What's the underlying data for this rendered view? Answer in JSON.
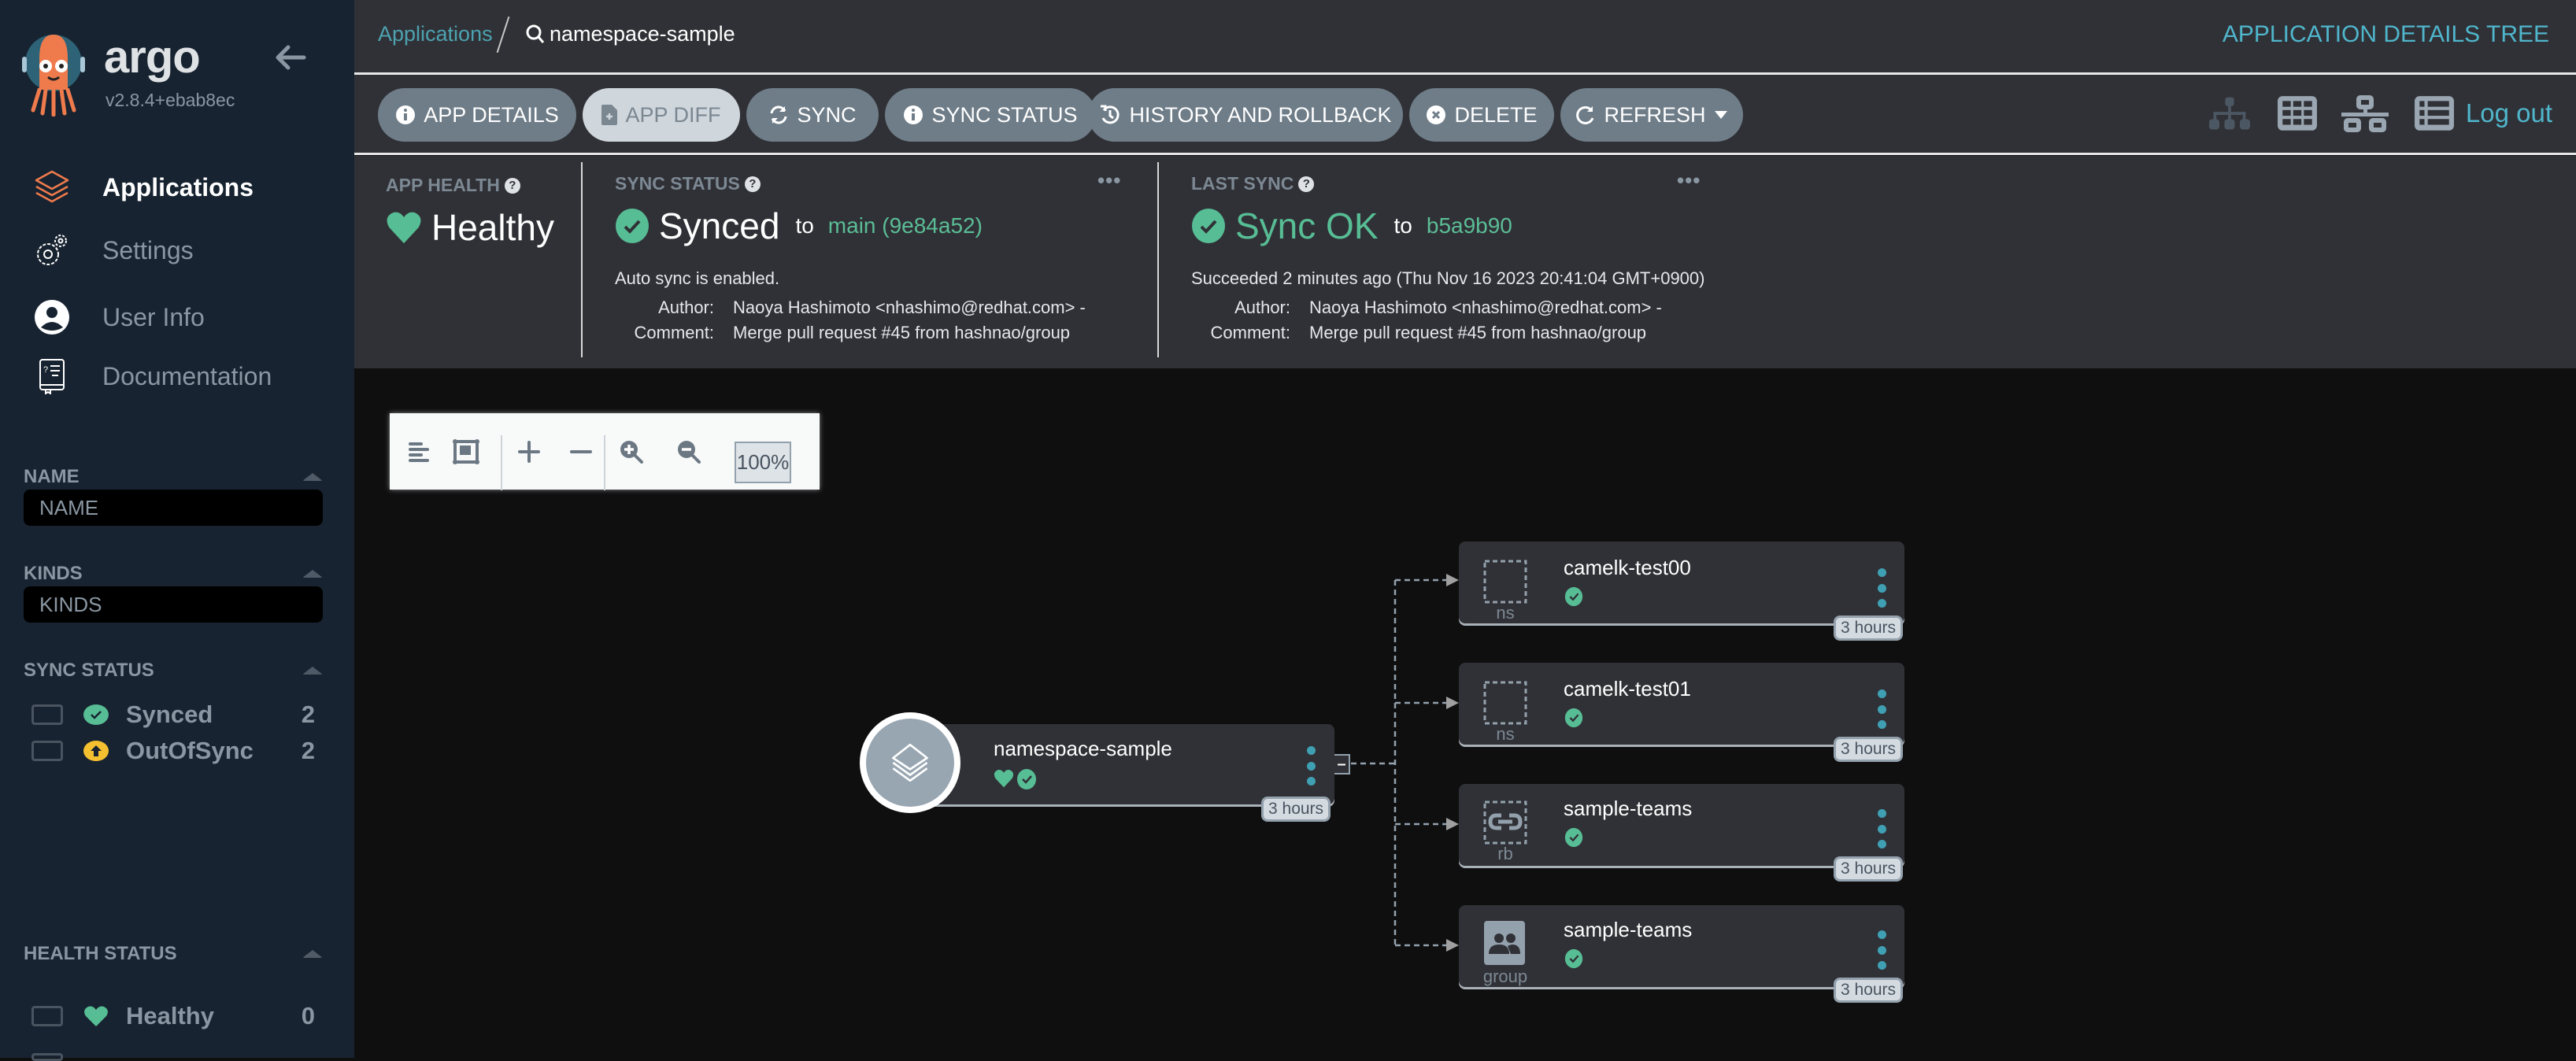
{
  "sidebar": {
    "brand": "argo",
    "version": "v2.8.4+ebab8ec",
    "nav": [
      {
        "label": "Applications",
        "icon": "layers-icon",
        "active": true
      },
      {
        "label": "Settings",
        "icon": "gears-icon"
      },
      {
        "label": "User Info",
        "icon": "user-circle-icon"
      },
      {
        "label": "Documentation",
        "icon": "book-icon"
      }
    ],
    "filters": {
      "name": {
        "title": "NAME",
        "placeholder": "NAME"
      },
      "kinds": {
        "title": "KINDS",
        "placeholder": "KINDS"
      },
      "sync_status": {
        "title": "SYNC STATUS",
        "items": [
          {
            "label": "Synced",
            "count": "2",
            "icon": "synced-check-icon",
            "color": "#57bd95"
          },
          {
            "label": "OutOfSync",
            "count": "2",
            "icon": "out-of-sync-arrow-icon",
            "color": "#f4c030"
          }
        ]
      },
      "health_status": {
        "title": "HEALTH STATUS",
        "items": [
          {
            "label": "Healthy",
            "count": "0",
            "icon": "heart-icon",
            "color": "#57bd95"
          }
        ]
      }
    }
  },
  "topbar": {
    "breadcrumb_root": "Applications",
    "breadcrumb_current": "namespace-sample",
    "page_title": "APPLICATION DETAILS TREE"
  },
  "toolbar": {
    "buttons": [
      {
        "label": "APP DETAILS",
        "icon": "info-icon"
      },
      {
        "label": "APP DIFF",
        "icon": "file-diff-icon",
        "disabled": true
      },
      {
        "label": "SYNC",
        "icon": "sync-icon"
      },
      {
        "label": "SYNC STATUS",
        "icon": "info-icon"
      },
      {
        "label": "HISTORY AND ROLLBACK",
        "icon": "history-icon"
      },
      {
        "label": "DELETE",
        "icon": "times-circle-icon"
      },
      {
        "label": "REFRESH",
        "icon": "redo-icon",
        "dropdown": true
      }
    ],
    "view_icons": [
      "tree-view-icon",
      "pods-grid-icon",
      "network-view-icon",
      "list-view-icon"
    ],
    "logout": "Log out"
  },
  "status": {
    "app_health": {
      "label": "APP HEALTH",
      "value": "Healthy"
    },
    "sync_status": {
      "label": "SYNC STATUS",
      "value": "Synced",
      "to": "to",
      "revision": "main (9e84a52)",
      "auto_sync": "Auto sync is enabled.",
      "author_key": "Author:",
      "author": "Naoya Hashimoto <nhashimo@redhat.com> -",
      "comment_key": "Comment:",
      "comment": "Merge pull request #45 from hashnao/group"
    },
    "last_sync": {
      "label": "LAST SYNC",
      "value": "Sync OK",
      "to": "to",
      "revision": "b5a9b90",
      "succeeded": "Succeeded 2 minutes ago (Thu Nov 16 2023 20:41:04 GMT+0900)",
      "author_key": "Author:",
      "author": "Naoya Hashimoto <nhashimo@redhat.com> -",
      "comment_key": "Comment:",
      "comment": "Merge pull request #45 from hashnao/group"
    },
    "more": "•••"
  },
  "graph": {
    "zoom_level": "100%",
    "root": {
      "name": "namespace-sample",
      "age": "3 hours",
      "health": "Healthy",
      "sync": "Synced",
      "collapse": "–"
    },
    "children": [
      {
        "name": "camelk-test00",
        "kind": "ns",
        "age": "3 hours",
        "sync": "Synced"
      },
      {
        "name": "camelk-test01",
        "kind": "ns",
        "age": "3 hours",
        "sync": "Synced"
      },
      {
        "name": "sample-teams",
        "kind": "rb",
        "age": "3 hours",
        "sync": "Synced"
      },
      {
        "name": "sample-teams",
        "kind": "group",
        "age": "3 hours",
        "sync": "Synced"
      }
    ]
  },
  "colors": {
    "sidebar_bg": "#172330",
    "panel_bg": "#303136",
    "canvas_bg": "#0f0f10",
    "accent": "#4fb6cc",
    "success": "#57bd95",
    "warning": "#f4c030",
    "argo_orange": "#ef7b4d"
  }
}
